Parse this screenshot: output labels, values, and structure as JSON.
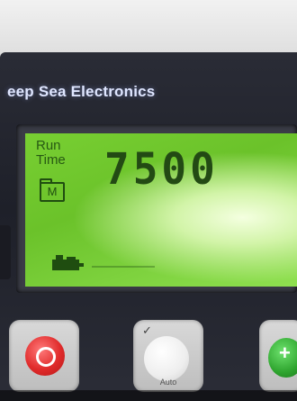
{
  "brand": {
    "text": "eep Sea Electronics"
  },
  "display": {
    "label_line1": "Run",
    "label_line2": "Time",
    "unit_icon_text": "M",
    "value": "7500"
  },
  "buttons": {
    "auto_label": "Auto"
  },
  "icons": {
    "unit": "meter-icon",
    "genset": "genset-icon",
    "stop": "stop-icon",
    "auto": "auto-icon",
    "start": "start-icon"
  },
  "colors": {
    "lcd_green": "#78cf32",
    "panel": "#1e2029",
    "stop_red": "#e02b2b",
    "start_green": "#2fa52f"
  },
  "caption": {
    "text": ""
  }
}
